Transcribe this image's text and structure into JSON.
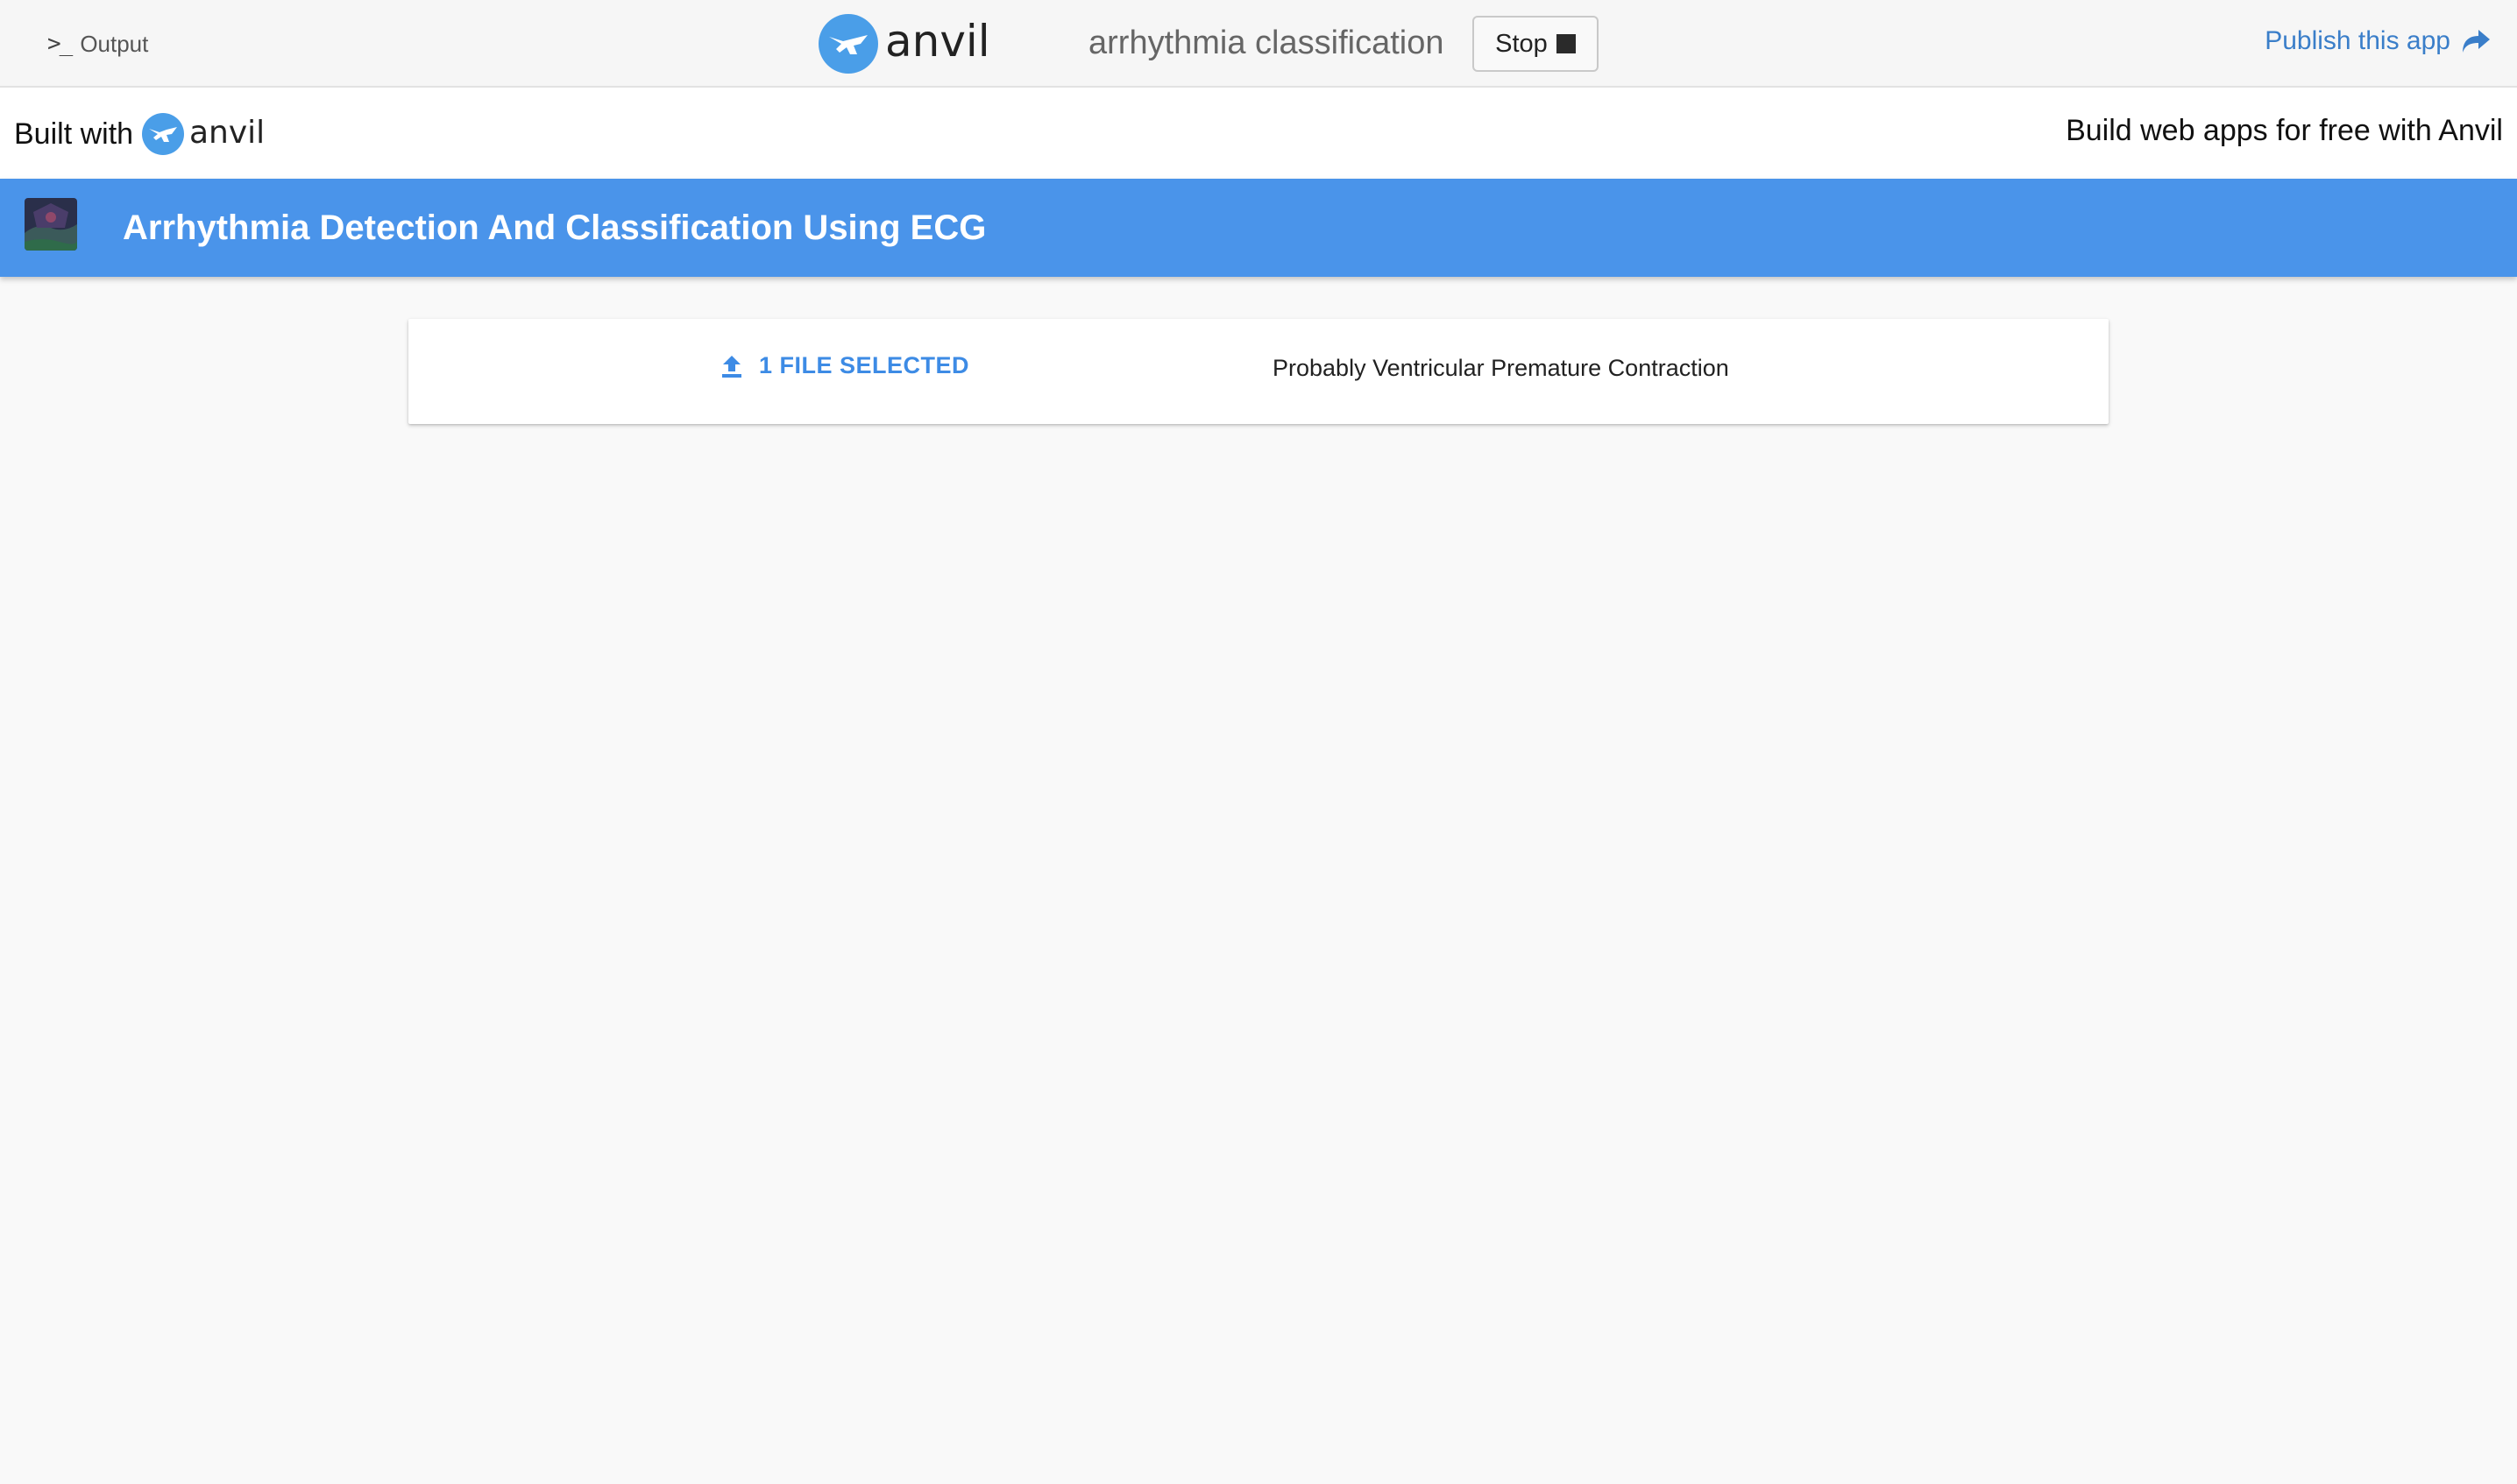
{
  "ide": {
    "output_label": "Output",
    "output_icon": "terminal-icon",
    "app_name": "arrhythmia classification",
    "stop_label": "Stop",
    "publish_label": "Publish this app",
    "brand_text": "anvil",
    "accent_color": "#3a7ec9"
  },
  "banner": {
    "built_with_label": "Built with",
    "brand_text": "anvil",
    "build_free_link": "Build web apps for free with Anvil"
  },
  "app": {
    "title": "Arrhythmia Detection And Classification Using ECG",
    "header_color": "#4a94ea",
    "upload_label": "1 FILE SELECTED",
    "upload_icon": "upload-icon",
    "result_text": "Probably Ventricular Premature Contraction"
  }
}
